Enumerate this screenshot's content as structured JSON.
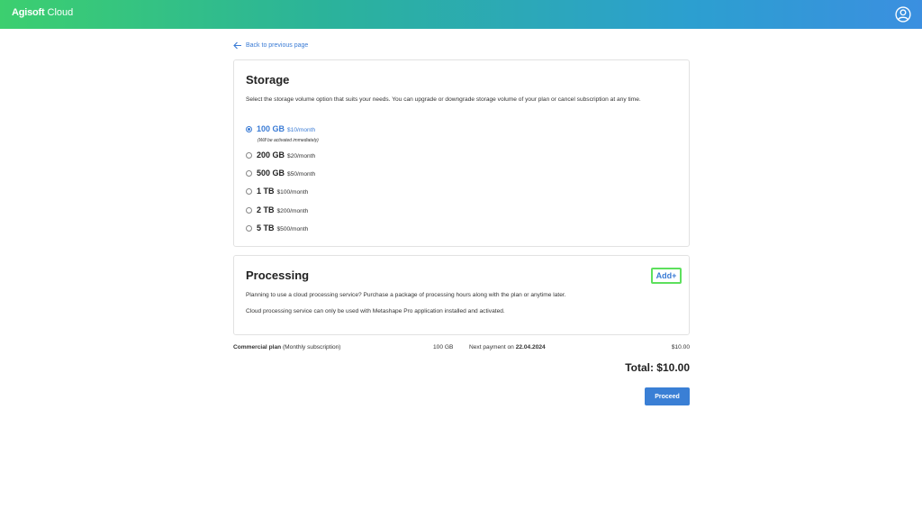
{
  "header": {
    "brand_bold": "Agisoft",
    "brand_rest": "Cloud",
    "profile_icon": "user-circle-icon"
  },
  "nav": {
    "back_label": "Back to previous page"
  },
  "storage": {
    "title": "Storage",
    "description": "Select the storage volume option that suits your needs. You can upgrade or downgrade storage volume of your plan or cancel subscription at any time.",
    "options": [
      {
        "size": "100 GB",
        "price": "$10/month",
        "selected": true
      },
      {
        "size": "200 GB",
        "price": "$20/month",
        "selected": false
      },
      {
        "size": "500 GB",
        "price": "$50/month",
        "selected": false
      },
      {
        "size": "1 TB",
        "price": "$100/month",
        "selected": false
      },
      {
        "size": "2 TB",
        "price": "$200/month",
        "selected": false
      },
      {
        "size": "5 TB",
        "price": "$500/month",
        "selected": false
      }
    ],
    "selected_note": "(Will be activated immediately)"
  },
  "processing": {
    "title": "Processing",
    "add_label": "Add+",
    "desc1": "Planning to use a cloud processing service? Purchase a package of processing hours along with the plan or anytime later.",
    "desc2": "Cloud processing service can only be used with Metashape Pro application installed and activated."
  },
  "summary": {
    "plan_bold": "Commercial plan",
    "plan_rest": "(Monthly subscription)",
    "size": "100 GB",
    "next_label": "Next payment on",
    "next_date": "22.04.2024",
    "price": "$10.00",
    "total": "Total: $10.00",
    "proceed_label": "Proceed"
  },
  "colors": {
    "accent": "#3a7bd5",
    "header_gradient_start": "#3ccf6f",
    "header_gradient_end": "#3b8fe0",
    "highlight_border": "#5de05d"
  }
}
